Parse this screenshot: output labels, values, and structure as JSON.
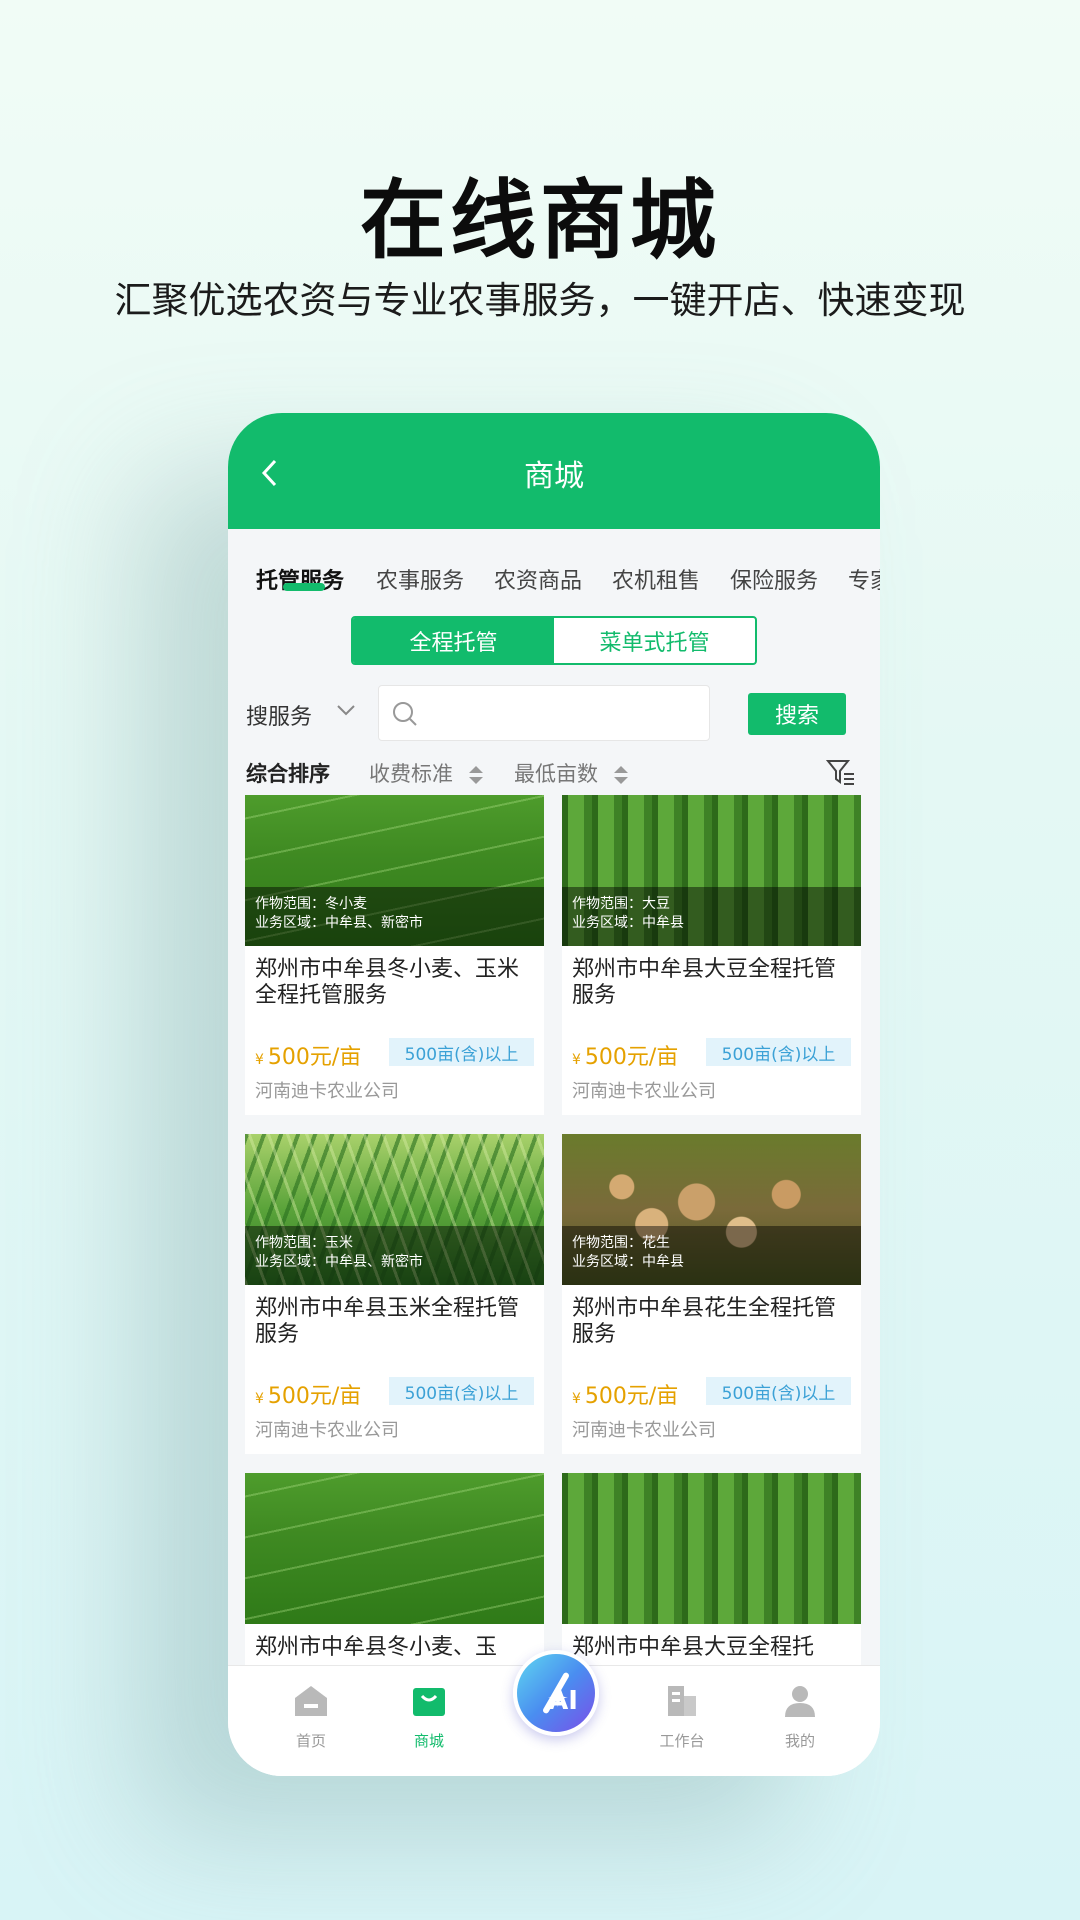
{
  "hero": {
    "title": "在线商城",
    "subtitle": "汇聚优选农资与专业农事服务，一键开店、快速变现"
  },
  "topbar": {
    "title": "商城",
    "back_icon": "chevron-left-icon"
  },
  "tabs": [
    {
      "label": "托管服务",
      "active": true
    },
    {
      "label": "农事服务"
    },
    {
      "label": "农资商品"
    },
    {
      "label": "农机租售"
    },
    {
      "label": "保险服务"
    },
    {
      "label": "专家"
    }
  ],
  "segment": {
    "on": "全程托管",
    "off": "菜单式托管"
  },
  "search": {
    "type_label": "搜服务",
    "placeholder": "",
    "button": "搜索"
  },
  "sort": {
    "items": [
      "综合排序",
      "收费标准",
      "最低亩数"
    ]
  },
  "cards": [
    {
      "crop_range": "作物范围：冬小麦",
      "area": "业务区域：中牟县、新密市",
      "title": "郑州市中牟县冬小麦、玉米全程托管服务",
      "yen": "¥",
      "price": "500元/亩",
      "tag": "500亩(含)以上",
      "company": "河南迪卡农业公司"
    },
    {
      "crop_range": "作物范围：大豆",
      "area": "业务区域：中牟县",
      "title": "郑州市中牟县大豆全程托管服务",
      "yen": "¥",
      "price": "500元/亩",
      "tag": "500亩(含)以上",
      "company": "河南迪卡农业公司"
    },
    {
      "crop_range": "作物范围：玉米",
      "area": "业务区域：中牟县、新密市",
      "title": "郑州市中牟县玉米全程托管服务",
      "yen": "¥",
      "price": "500元/亩",
      "tag": "500亩(含)以上",
      "company": "河南迪卡农业公司"
    },
    {
      "crop_range": "作物范围：花生",
      "area": "业务区域：中牟县",
      "title": "郑州市中牟县花生全程托管服务",
      "yen": "¥",
      "price": "500元/亩",
      "tag": "500亩(含)以上",
      "company": "河南迪卡农业公司"
    },
    {
      "crop_range": "",
      "area": "",
      "title": "郑州市中牟县冬小麦、玉",
      "yen": "",
      "price": "",
      "tag": "",
      "company": ""
    },
    {
      "crop_range": "",
      "area": "",
      "title": "郑州市中牟县大豆全程托",
      "yen": "",
      "price": "",
      "tag": "",
      "company": ""
    }
  ],
  "bottom_nav": [
    {
      "label": "首页",
      "icon": "home-icon"
    },
    {
      "label": "商城",
      "icon": "shop-bag-icon",
      "active": true
    },
    {
      "label": "AI",
      "icon": "ai-assistant-icon"
    },
    {
      "label": "工作台",
      "icon": "workbench-building-icon"
    },
    {
      "label": "我的",
      "icon": "profile-icon"
    }
  ],
  "colors": {
    "brand": "#12bb6c",
    "price": "#e5a100",
    "tag_bg": "#e2f3fb",
    "tag_text": "#3ba1d6"
  }
}
